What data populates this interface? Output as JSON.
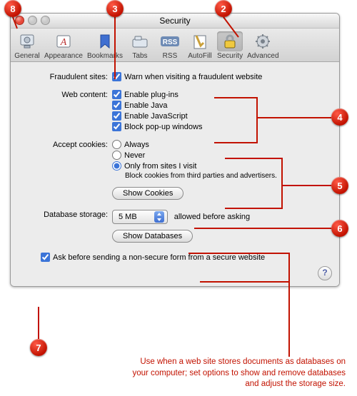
{
  "window": {
    "title": "Security"
  },
  "toolbar": {
    "items": [
      {
        "label": "General",
        "icon": "general"
      },
      {
        "label": "Appearance",
        "icon": "appearance"
      },
      {
        "label": "Bookmarks",
        "icon": "bookmarks"
      },
      {
        "label": "Tabs",
        "icon": "tabs"
      },
      {
        "label": "RSS",
        "icon": "rss"
      },
      {
        "label": "AutoFill",
        "icon": "autofill"
      },
      {
        "label": "Security",
        "icon": "security"
      },
      {
        "label": "Advanced",
        "icon": "advanced"
      }
    ]
  },
  "sections": {
    "fraud": {
      "label": "Fraudulent sites:",
      "option": "Warn when visiting a fraudulent website"
    },
    "web": {
      "label": "Web content:",
      "opts": [
        "Enable plug-ins",
        "Enable Java",
        "Enable JavaScript",
        "Block pop-up windows"
      ]
    },
    "cookies": {
      "label": "Accept cookies:",
      "opts": [
        "Always",
        "Never",
        "Only from sites I visit"
      ],
      "sub": "Block cookies from third parties and advertisers.",
      "btn": "Show Cookies"
    },
    "db": {
      "label": "Database storage:",
      "value": "5 MB",
      "suffix": "allowed before asking",
      "btn": "Show Databases"
    },
    "ask": "Ask before sending a non-secure form from a secure website"
  },
  "callouts": {
    "2": "2",
    "3": "3",
    "4": "4",
    "5": "5",
    "6": "6",
    "7": "7",
    "8": "8"
  },
  "caption": "Use when a web site stores documents as databases on your computer; set options to show and remove databases and adjust the storage size."
}
